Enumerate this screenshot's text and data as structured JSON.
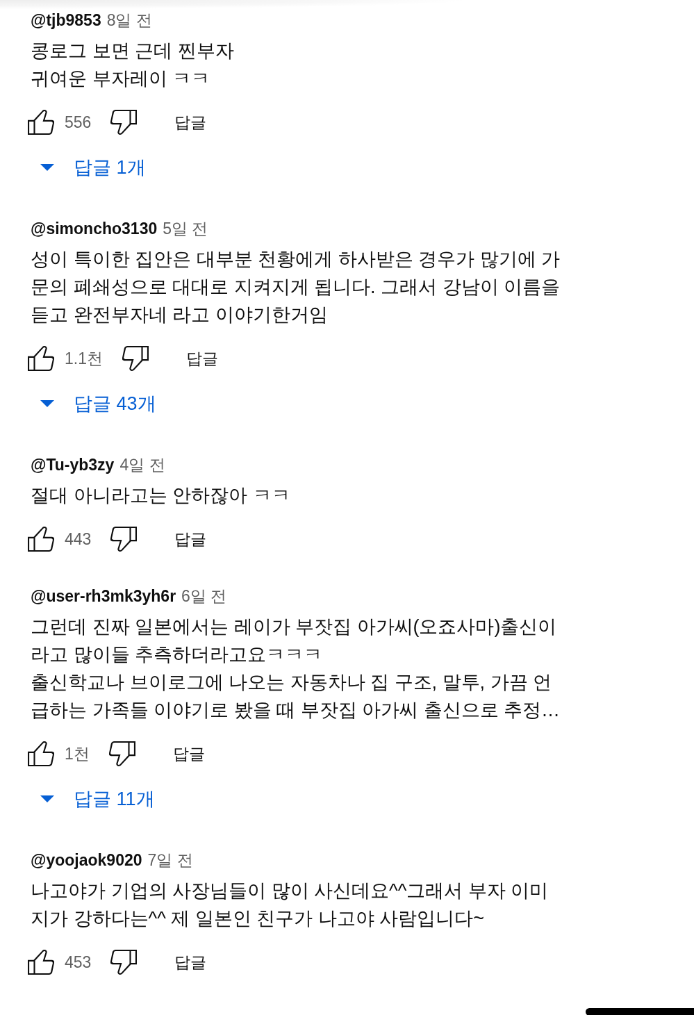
{
  "comments": [
    {
      "author": "@tjb9853",
      "time": "8일 전",
      "lines": [
        "콩로그 보면 근데 찐부자",
        "귀여운 부자레이 ㅋㅋ"
      ],
      "likes": "556",
      "reply_label": "답글",
      "replies": {
        "label": "답글 1개"
      }
    },
    {
      "author": "@simoncho3130",
      "time": "5일 전",
      "lines": [
        "성이 특이한 집안은 대부분 천황에게 하사받은 경우가 많기에 가",
        "문의 폐쇄성으로 대대로 지켜지게 됩니다. 그래서 강남이 이름을",
        "듣고 완전부자네 라고 이야기한거임"
      ],
      "likes": "1.1천",
      "reply_label": "답글",
      "replies": {
        "label": "답글 43개"
      }
    },
    {
      "author": "@Tu-yb3zy",
      "time": "4일 전",
      "lines": [
        "절대 아니라고는 안하잖아 ㅋㅋ"
      ],
      "likes": "443",
      "reply_label": "답글"
    },
    {
      "author": "@user-rh3mk3yh6r",
      "time": "6일 전",
      "lines": [
        "그런데 진짜 일본에서는 레이가 부잣집 아가씨(오죠사마)출신이",
        "라고 많이들 추측하더라고요ㅋㅋㅋ",
        "출신학교나 브이로그에 나오는 자동차나 집 구조, 말투, 가끔 언",
        "급하는 가족들 이야기로 봤을 때 부잣집 아가씨 출신으로 추정…"
      ],
      "likes": "1천",
      "reply_label": "답글",
      "replies": {
        "label": "답글 11개"
      }
    },
    {
      "author": "@yoojaok9020",
      "time": "7일 전",
      "lines": [
        "나고야가 기업의 사장님들이 많이 사신데요^^그래서 부자 이미",
        "지가 강하다는^^ 제 일본인 친구가 나고야 사람입니다~"
      ],
      "likes": "453",
      "reply_label": "답글"
    }
  ]
}
